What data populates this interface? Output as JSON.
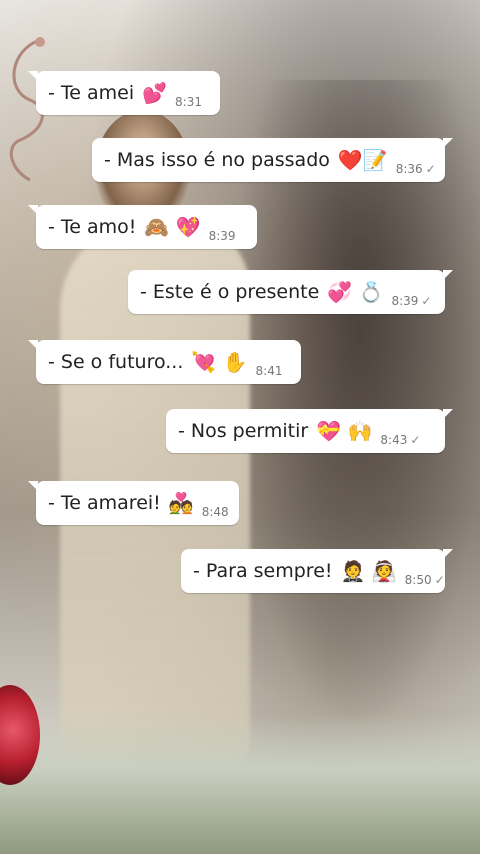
{
  "messages": [
    {
      "text": "- Te amei",
      "emoji": "💕",
      "time": "8:31",
      "side": "in"
    },
    {
      "text": "- Mas isso é no passado",
      "emoji": "❤️📝",
      "time": "8:36",
      "side": "out",
      "tick": "✓"
    },
    {
      "text": "- Te amo!",
      "emoji": "🙈 💖",
      "time": "8:39",
      "side": "in"
    },
    {
      "text": "- Este é o presente",
      "emoji": "💞 💍",
      "time": "8:39",
      "side": "out",
      "tick": "✓"
    },
    {
      "text": "- Se o futuro...",
      "emoji": "💘 ✋",
      "time": "8:41",
      "side": "in"
    },
    {
      "text": "- Nos permitir",
      "emoji": "💝 🙌",
      "time": "8:43",
      "side": "out",
      "tick": "✓"
    },
    {
      "text": "- Te amarei!",
      "emoji": "💑",
      "time": "8:48",
      "side": "in"
    },
    {
      "text": "- Para sempre!",
      "emoji": "🤵 👰",
      "time": "8:50",
      "side": "out",
      "tick": "✓"
    }
  ]
}
